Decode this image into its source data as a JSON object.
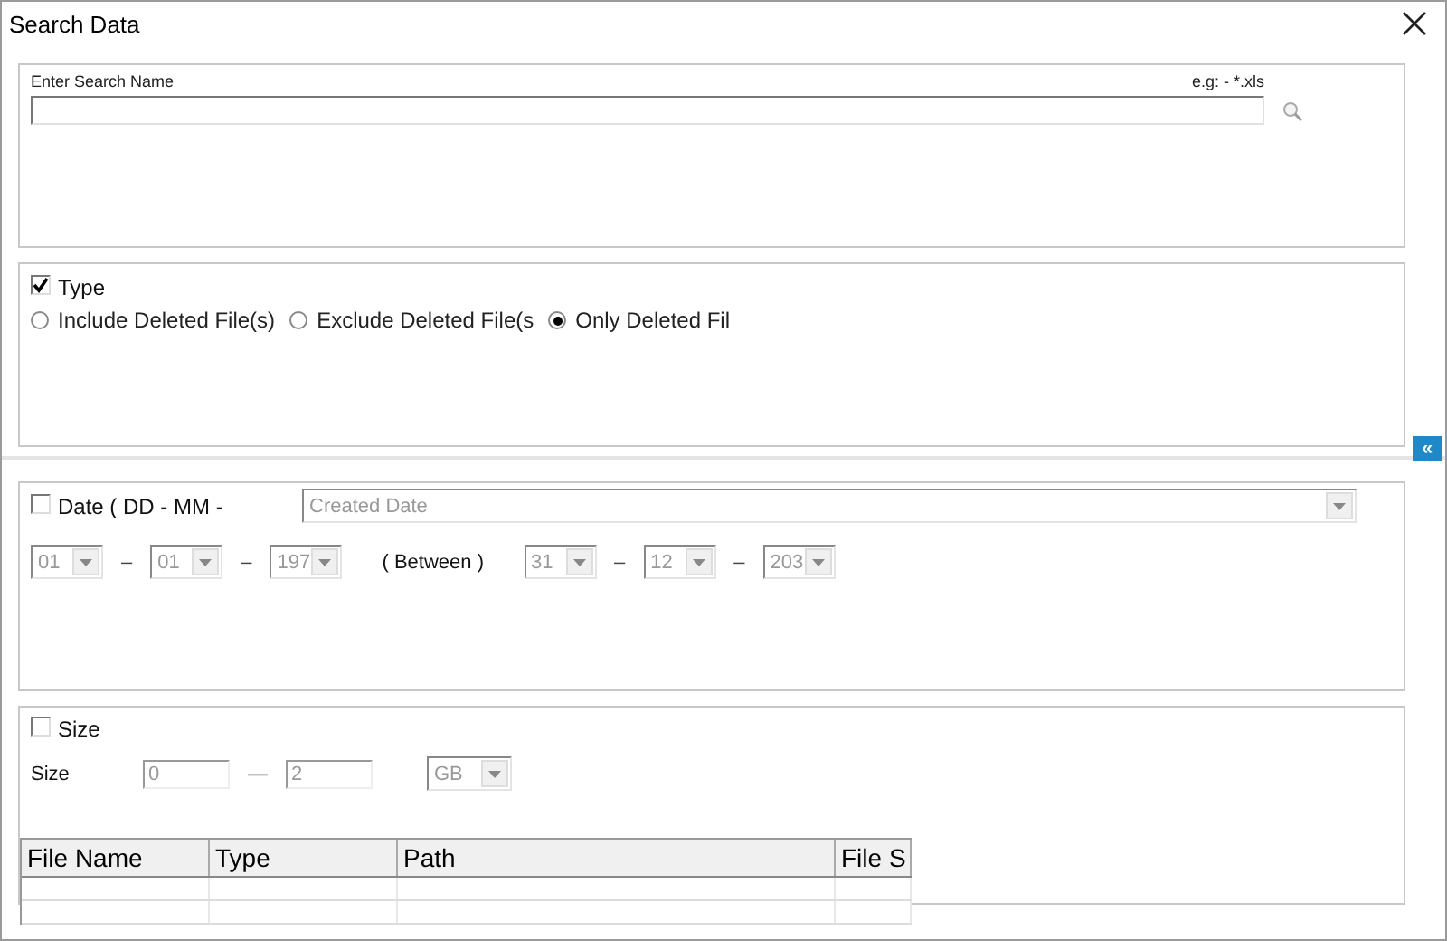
{
  "window": {
    "title": "Search Data"
  },
  "search_panel": {
    "label": "Enter Search Name",
    "hint": "e.g: - *.xls"
  },
  "type_panel": {
    "label": "Type",
    "checked": true,
    "options": [
      {
        "label": "Include Deleted File(s)",
        "selected": false
      },
      {
        "label": "Exclude Deleted File(s",
        "selected": false
      },
      {
        "label": "Only Deleted Fil",
        "selected": true
      }
    ]
  },
  "collapse_button": "«",
  "date_panel": {
    "label": "Date ( DD - MM -",
    "checked": false,
    "date_field": "Created Date",
    "from": [
      "01",
      "01",
      "197"
    ],
    "separator": "–",
    "between": "( Between )",
    "to": [
      "31",
      "12",
      "203"
    ]
  },
  "size_panel": {
    "label": "Size",
    "checked": false,
    "size_label": "Size",
    "min": "0",
    "separator": "—",
    "max": "2",
    "unit": "GB"
  },
  "results_table": {
    "columns": [
      "File Name",
      "Type",
      "Path",
      "File S"
    ]
  }
}
